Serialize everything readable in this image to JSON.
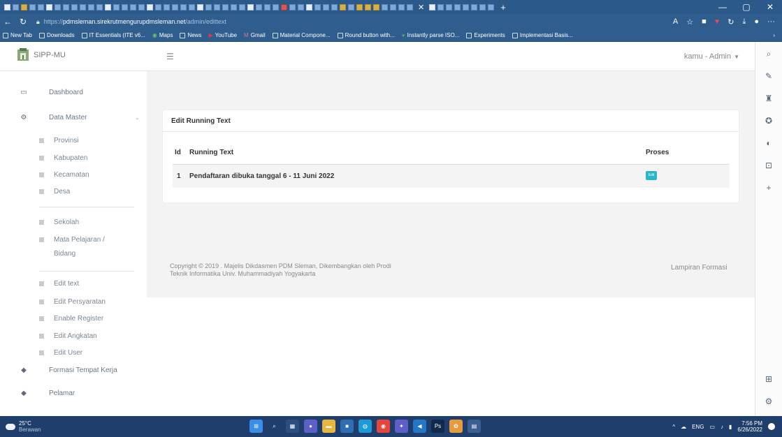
{
  "browser": {
    "url_scheme": "https://",
    "url_host": "pdmsleman.sirekrutmengurupdmsleman.net",
    "url_path": "/admin/edittext",
    "bookmarks": [
      {
        "label": "New Tab"
      },
      {
        "label": "Downloads"
      },
      {
        "label": "IT Essentials (ITE v6..."
      },
      {
        "label": "Maps"
      },
      {
        "label": "News"
      },
      {
        "label": "YouTube"
      },
      {
        "label": "Gmail"
      },
      {
        "label": "Material Compone..."
      },
      {
        "label": "Round button with..."
      },
      {
        "label": "Instantly parse ISO..."
      },
      {
        "label": "Experiments"
      },
      {
        "label": "Implementasi Basis..."
      }
    ]
  },
  "app": {
    "brand": "SIPP-MU",
    "user_menu": "kamu - Admin"
  },
  "sidebar": {
    "dashboard": "Dashboard",
    "data_master": "Data Master",
    "sub1": [
      "Provinsi",
      "Kabupaten",
      "Kecamatan",
      "Desa"
    ],
    "sub2": [
      "Sekolah",
      "Mata Pelajaran /",
      "Bidang"
    ],
    "sub3": [
      "Edit text",
      "Edit Persyaratan",
      "Enable Register",
      "Edit Angkatan",
      "Edit User"
    ],
    "formasi": "Formasi Tempat Kerja",
    "pelamar": "Pelamar"
  },
  "card": {
    "title": "Edit Running Text",
    "headers": {
      "id": "Id",
      "text": "Running Text",
      "proses": "Proses"
    },
    "rows": [
      {
        "id": "1",
        "text": "Pendaftaran dibuka tanggal 6 - 11 Juni 2022",
        "action": "Edit"
      }
    ]
  },
  "footer": {
    "line1": "Copyright © 2019 . Majelis Dikdasmen PDM Sleman, Dikembangkan oleh Prodi",
    "line2": "Teknik Informatika Univ. Muhammadiyah Yogyakarta",
    "right": "Lampiran Formasi"
  },
  "taskbar": {
    "temp": "25°C",
    "weather": "Berawan",
    "lang": "ENG",
    "time": "7:56 PM",
    "date": "6/26/2022"
  }
}
